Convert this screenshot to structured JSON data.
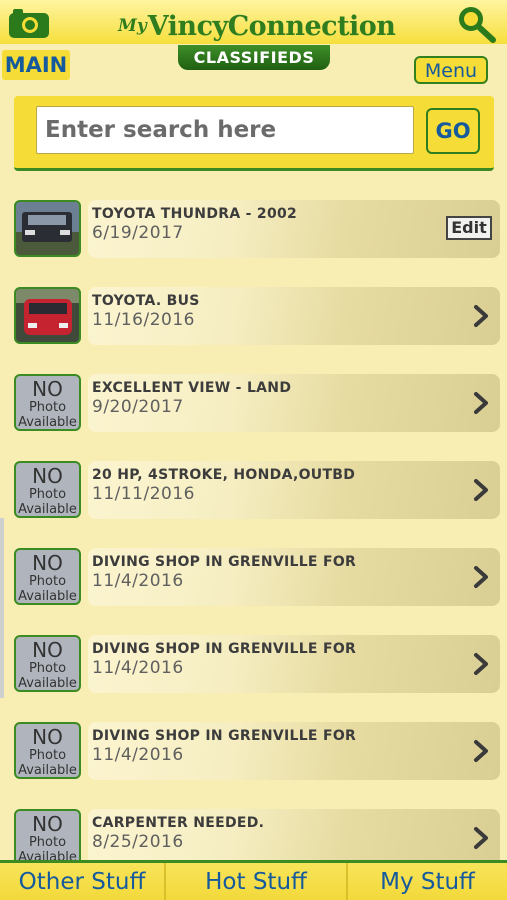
{
  "header": {
    "logo_my": "My",
    "logo_name": "VincyConnection",
    "icons": {
      "left": "camera-icon",
      "right": "search-icon"
    }
  },
  "tabs": {
    "main": "MAIN",
    "section": "CLASSIFIEDS",
    "menu": "Menu"
  },
  "search": {
    "placeholder": "Enter search here",
    "button": "GO"
  },
  "listings": [
    {
      "title": "TOYOTA THUNDRA - 2002",
      "date": "6/19/2017",
      "photo": "truck",
      "action": "Edit"
    },
    {
      "title": "TOYOTA. BUS",
      "date": "11/16/2016",
      "photo": "red-van",
      "action": "chevron"
    },
    {
      "title": "EXCELLENT VIEW - LAND",
      "date": "9/20/2017",
      "photo": "none",
      "action": "chevron"
    },
    {
      "title": "20 HP, 4STROKE, HONDA,OUTBD",
      "date": "11/11/2016",
      "photo": "none",
      "action": "chevron"
    },
    {
      "title": "DIVING SHOP IN GRENVILLE FOR",
      "date": "11/4/2016",
      "photo": "none",
      "action": "chevron"
    },
    {
      "title": "DIVING SHOP IN GRENVILLE FOR",
      "date": "11/4/2016",
      "photo": "none",
      "action": "chevron"
    },
    {
      "title": "DIVING SHOP IN GRENVILLE FOR",
      "date": "11/4/2016",
      "photo": "none",
      "action": "chevron"
    },
    {
      "title": "CARPENTER NEEDED.",
      "date": "8/25/2016",
      "photo": "none",
      "action": "chevron"
    }
  ],
  "no_photo": {
    "line1": "NO",
    "line2": "Photo",
    "line3": "Available"
  },
  "bottom_nav": [
    "Other Stuff",
    "Hot Stuff",
    "My Stuff"
  ],
  "colors": {
    "background": "#f8eeb4",
    "yellow": "#f6dc36",
    "green": "#3b8b22",
    "blue_text": "#155a9c"
  }
}
